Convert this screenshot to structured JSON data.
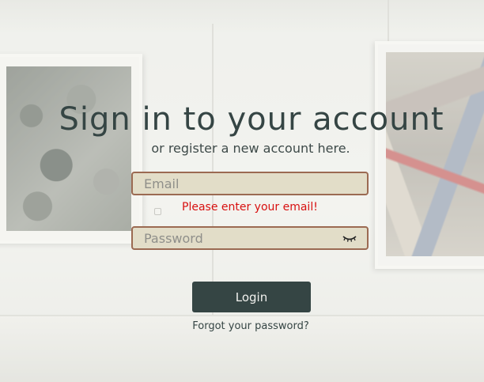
{
  "header": {
    "title": "Sign in to your account",
    "subtitle": "or register a new account here."
  },
  "form": {
    "email_placeholder": "Email",
    "email_value": "",
    "email_error": "Please enter your email!",
    "password_placeholder": "Password",
    "password_value": "",
    "toggle_icon": "eye-closed-icon",
    "login_label": "Login",
    "forgot_label": "Forgot your password?"
  },
  "colors": {
    "primary": "#354544",
    "field_bg": "#e2ddc8",
    "field_border": "#9b6a52",
    "error": "#d81010"
  }
}
